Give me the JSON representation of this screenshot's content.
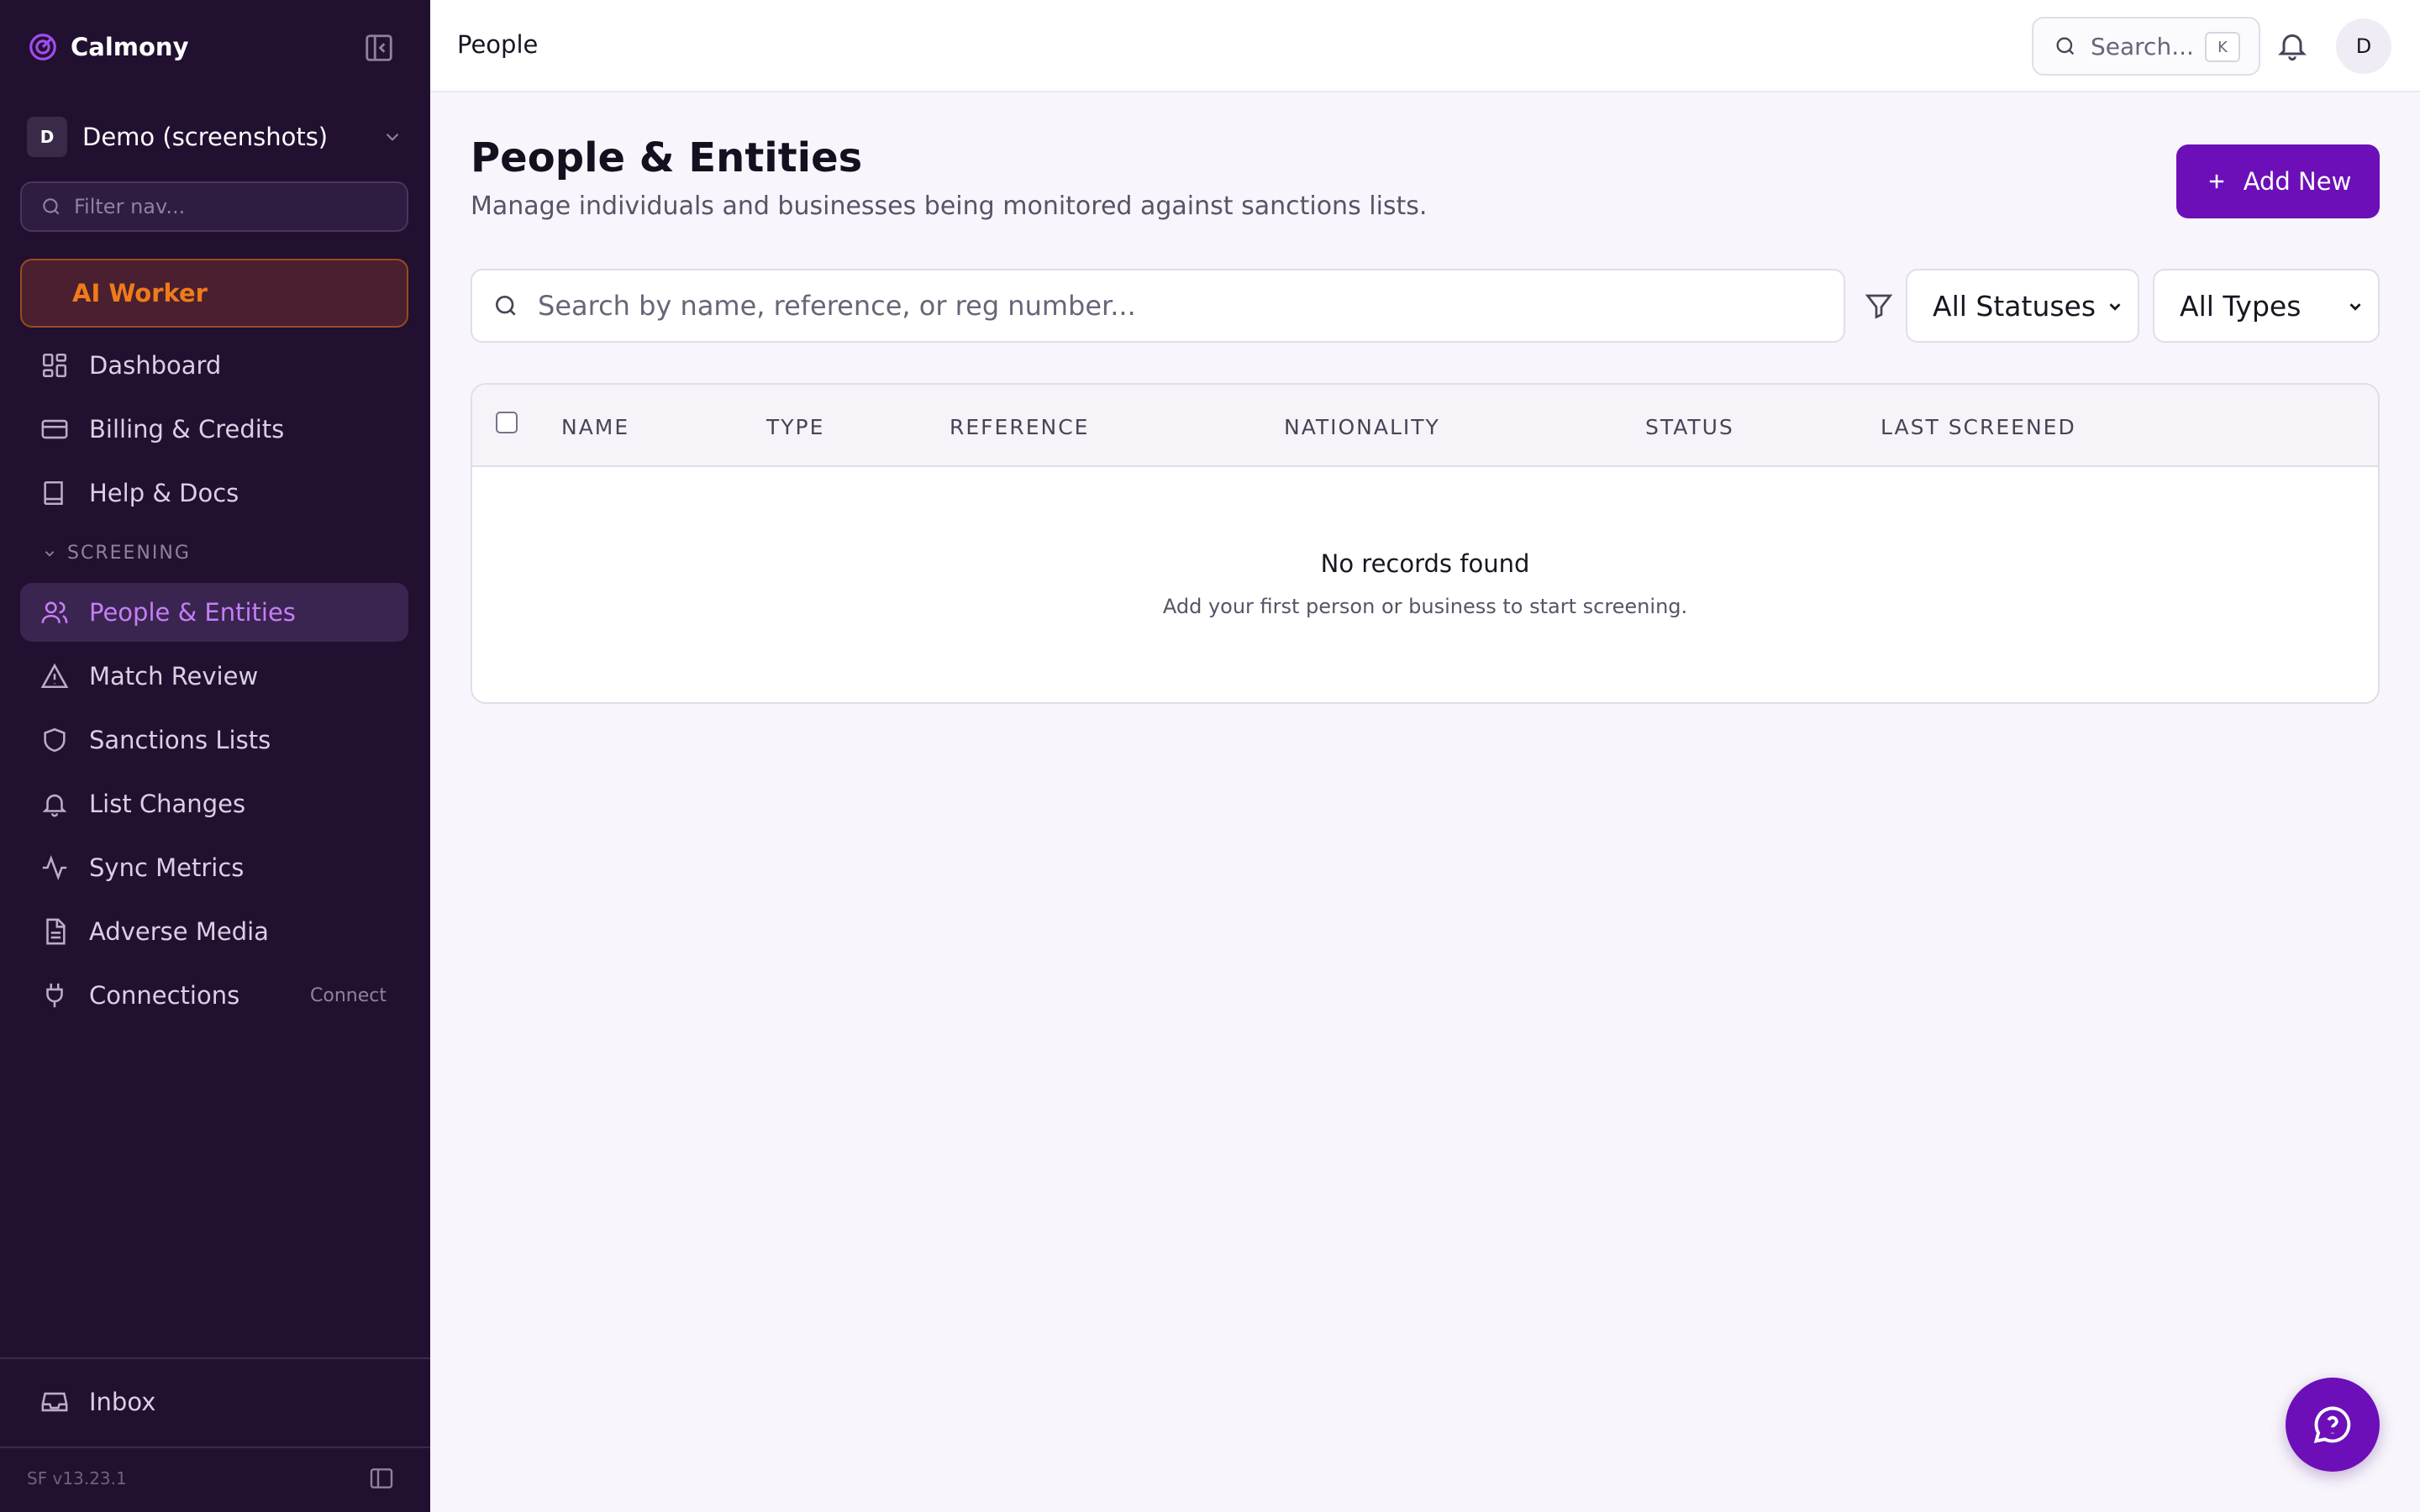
{
  "app": {
    "name": "Calmony",
    "version": "SF v13.23.1"
  },
  "org": {
    "initial": "D",
    "name": "Demo (screenshots)"
  },
  "sidebar": {
    "filter_placeholder": "Filter nav...",
    "ai_worker_label": "AI Worker",
    "items": [
      {
        "label": "Dashboard",
        "icon": "dashboard-icon"
      },
      {
        "label": "Billing & Credits",
        "icon": "credit-card-icon"
      },
      {
        "label": "Help & Docs",
        "icon": "book-icon"
      }
    ],
    "section_label": "SCREENING",
    "screening_items": [
      {
        "label": "People & Entities",
        "icon": "users-icon",
        "active": true
      },
      {
        "label": "Match Review",
        "icon": "alert-triangle-icon"
      },
      {
        "label": "Sanctions Lists",
        "icon": "shield-icon"
      },
      {
        "label": "List Changes",
        "icon": "bell-icon"
      },
      {
        "label": "Sync Metrics",
        "icon": "activity-icon"
      },
      {
        "label": "Adverse Media",
        "icon": "file-text-icon"
      },
      {
        "label": "Connections",
        "icon": "plug-icon",
        "meta": "Connect"
      }
    ],
    "inbox_label": "Inbox"
  },
  "topbar": {
    "title": "People",
    "search_label": "Search...",
    "search_shortcut": "K",
    "user_initial": "D"
  },
  "main": {
    "title": "People & Entities",
    "subtitle": "Manage individuals and businesses being monitored against sanctions lists.",
    "add_button_label": "Add New",
    "search_placeholder": "Search by name, reference, or reg number...",
    "status_filter": "All Statuses",
    "type_filter": "All Types",
    "table": {
      "columns": [
        "NAME",
        "TYPE",
        "REFERENCE",
        "NATIONALITY",
        "STATUS",
        "LAST SCREENED"
      ],
      "empty_title": "No records found",
      "empty_subtitle": "Add your first person or business to start screening."
    }
  },
  "colors": {
    "sidebar_bg": "#221030",
    "accent": "#6c0fb8",
    "active_nav": "#c57ef5",
    "ai_worker": "#f07b1a"
  }
}
